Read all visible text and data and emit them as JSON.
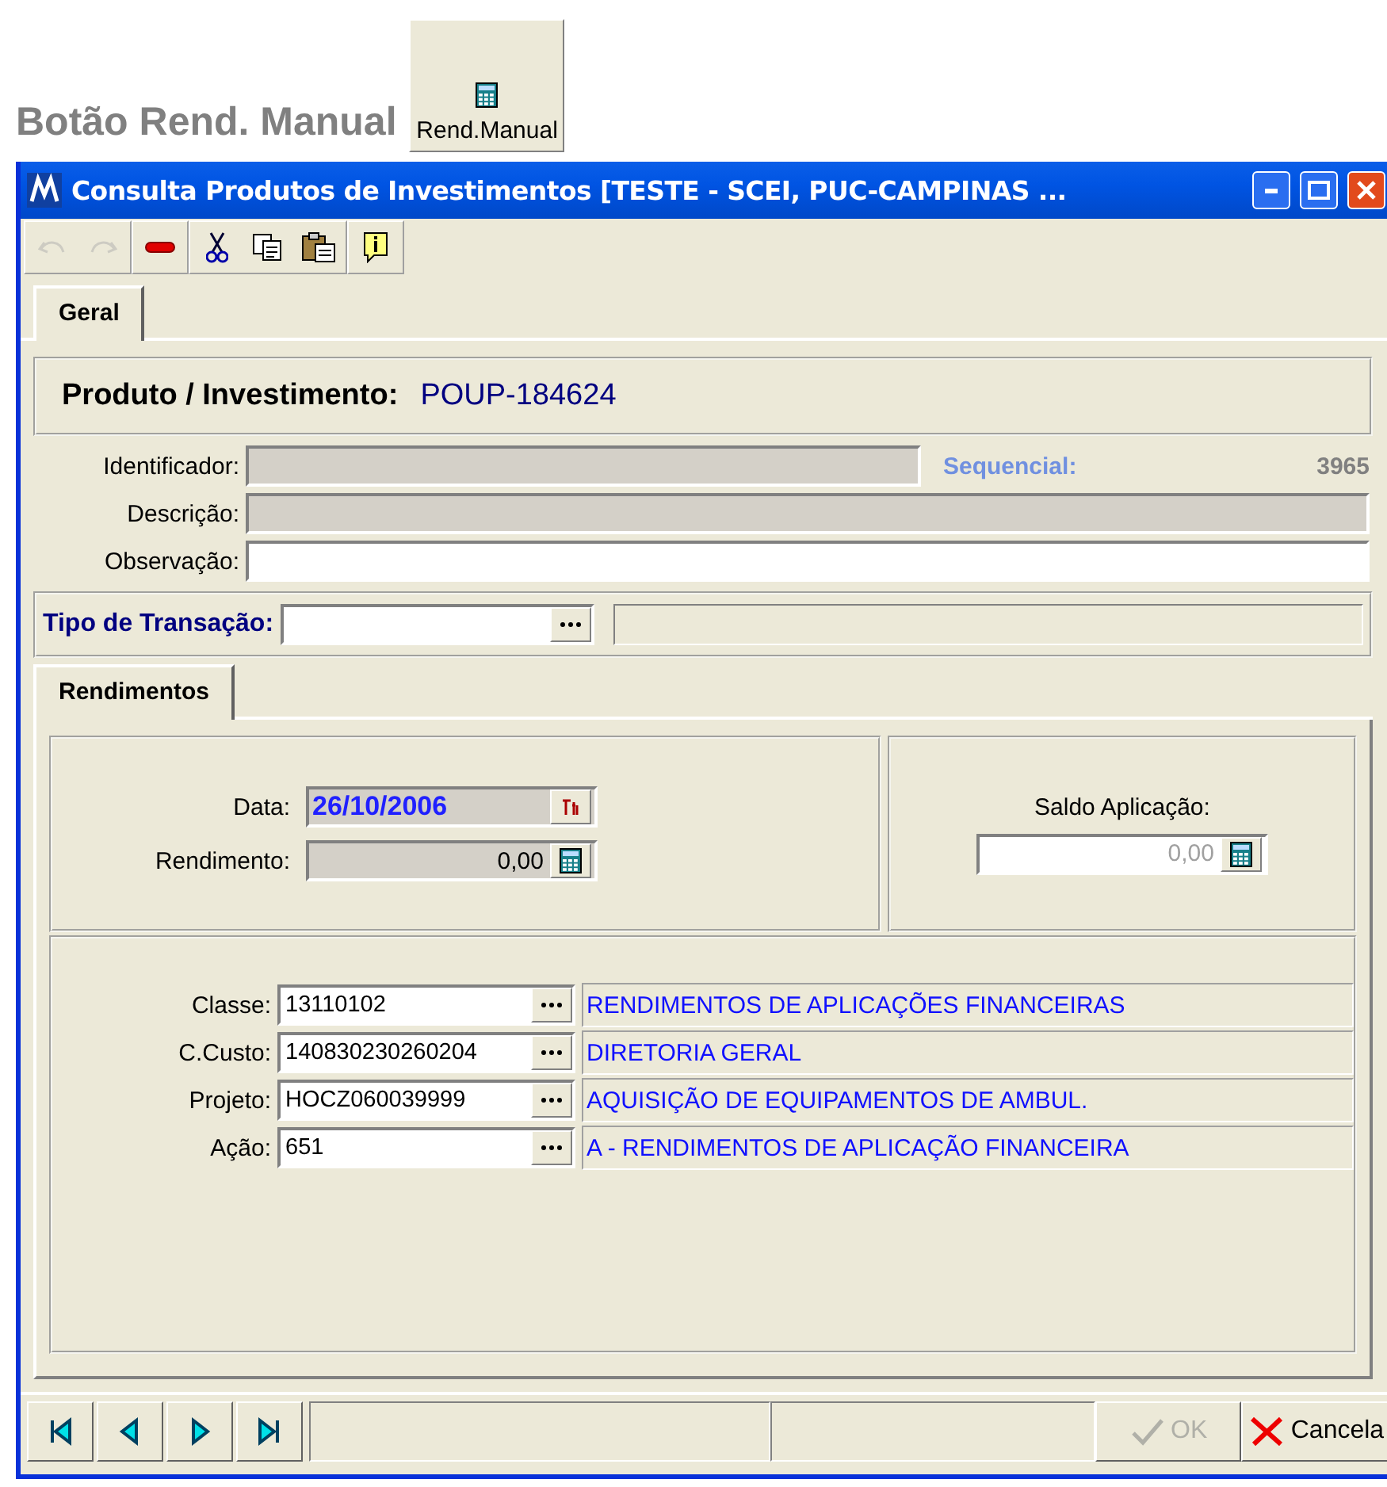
{
  "caption": {
    "text": "Botão Rend. Manual",
    "button_label": "Rend.Manual"
  },
  "window": {
    "title": "Consulta Produtos de Investimentos [TESTE - SCEI, PUC-CAMPINAS ..."
  },
  "toolbar": [
    {
      "kind": "undo",
      "disabled": true
    },
    {
      "kind": "redo",
      "disabled": true
    },
    {
      "kind": "delete",
      "disabled": false
    },
    {
      "kind": "cut",
      "disabled": false
    },
    {
      "kind": "copy",
      "disabled": false
    },
    {
      "kind": "paste",
      "disabled": false
    },
    {
      "kind": "info",
      "disabled": false
    }
  ],
  "tabs": [
    {
      "label": "Geral",
      "selected": true
    }
  ],
  "product": {
    "label": "Produto / Investimento:",
    "value": "POUP-184624"
  },
  "identificador": {
    "label": "Identificador:"
  },
  "sequencial": {
    "label": "Sequencial:",
    "value": "3965"
  },
  "descricao": {
    "label": "Descrição:"
  },
  "observacao": {
    "label": "Observação:"
  },
  "transaction": {
    "label": "Tipo de Transação:"
  },
  "subtabs": [
    {
      "label": "Rendimentos",
      "selected": true
    }
  ],
  "data": {
    "label": "Data:",
    "value": "26/10/2006"
  },
  "rendimento": {
    "label": "Rendimento:",
    "value": "0,00"
  },
  "saldo": {
    "label": "Saldo Aplicação:",
    "value": "0,00"
  },
  "lookups": [
    {
      "label": "Classe:",
      "code": "13110102",
      "description": "RENDIMENTOS DE APLICAÇÕES FINANCEIRAS"
    },
    {
      "label": "C.Custo:",
      "code": "140830230260204",
      "description": "DIRETORIA GERAL"
    },
    {
      "label": "Projeto:",
      "code": "HOCZ060039999",
      "description": "AQUISIÇÃO DE EQUIPAMENTOS DE AMBUL."
    },
    {
      "label": "Ação:",
      "code": "651",
      "description": "A - RENDIMENTOS DE APLICAÇÃO FINANCEIRA"
    }
  ],
  "navigation": [
    {
      "kind": "first"
    },
    {
      "kind": "previous"
    },
    {
      "kind": "next"
    },
    {
      "kind": "last"
    }
  ],
  "buttons": [
    {
      "kind": "ok",
      "label": "OK",
      "disabled": true
    },
    {
      "kind": "cancel",
      "label": "Cancela",
      "disabled": false
    }
  ]
}
